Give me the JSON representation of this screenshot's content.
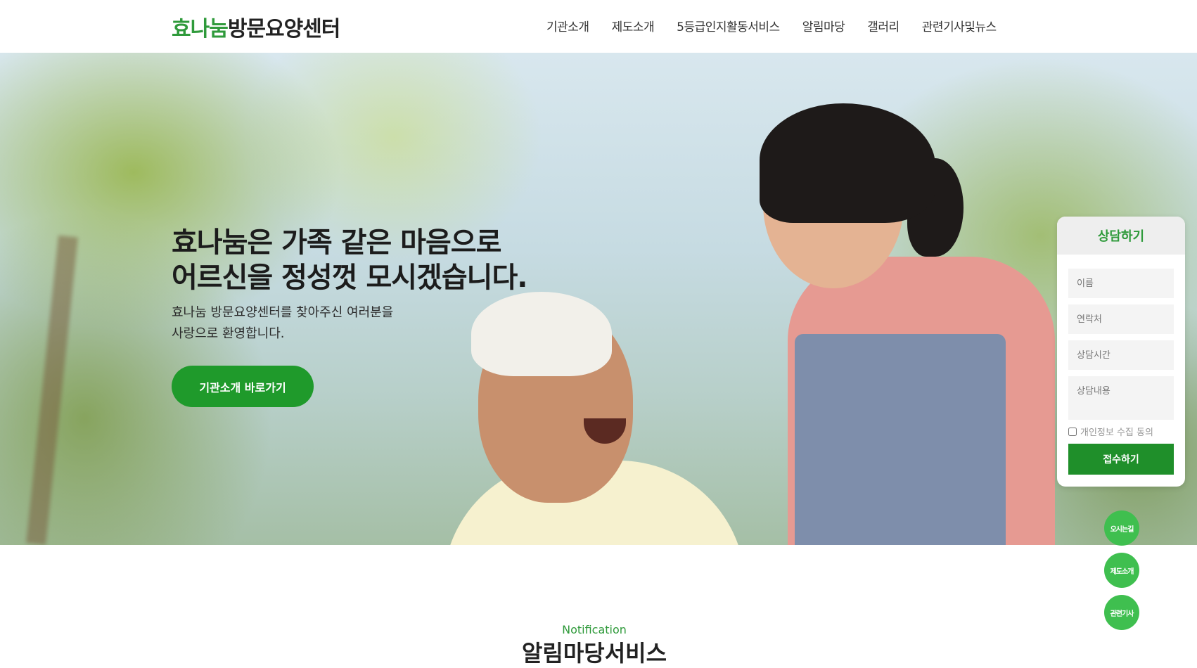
{
  "header": {
    "logo_green": "효나눔",
    "logo_dark": "방문요양센터",
    "nav": [
      "기관소개",
      "제도소개",
      "5등급인지활동서비스",
      "알림마당",
      "갤러리",
      "관련기사및뉴스"
    ]
  },
  "hero": {
    "title_line1": "효나눔은 가족 같은 마음으로",
    "title_line2": "어르신을 정성껏 모시겠습니다.",
    "sub_line1": "효나눔 방문요양센터를 찾아주신 여러분을",
    "sub_line2": "사랑으로 환영합니다.",
    "button_label": "기관소개 바로가기"
  },
  "consult": {
    "title": "상담하기",
    "name_placeholder": "이름",
    "phone_placeholder": "연락처",
    "time_placeholder": "상담시간",
    "content_placeholder": "상담내용",
    "agree_label": "개인정보 수집 동의",
    "submit_label": "접수하기"
  },
  "floating": {
    "btn1": "오시는길",
    "btn2": "제도소개",
    "btn3": "관련기사"
  },
  "section": {
    "eyebrow": "Notification",
    "title": "알림마당서비스"
  },
  "colors": {
    "brand_green": "#2f9a3b",
    "button_green": "#1f9a2b",
    "float_green": "#3fbf4f"
  }
}
